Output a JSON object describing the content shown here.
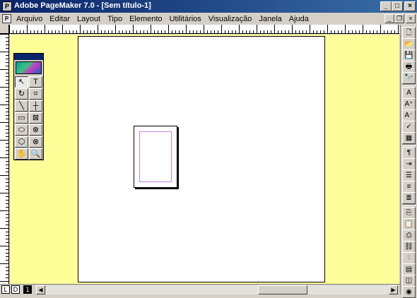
{
  "window": {
    "title": "Adobe PageMaker 7.0 - [Sem título-1]",
    "app_icon_label": "P",
    "minimize": "_",
    "maximize": "□",
    "close": "×"
  },
  "menubar": {
    "doc_icon_label": "P",
    "items": [
      "Arquivo",
      "Editar",
      "Layout",
      "Tipo",
      "Elemento",
      "Utilitários",
      "Visualização",
      "Janela",
      "Ajuda"
    ],
    "mdi_minimize": "_",
    "mdi_restore": "❐",
    "mdi_close": "×"
  },
  "toolbox": {
    "tools": [
      {
        "name": "pointer-tool-icon",
        "glyph": "↖"
      },
      {
        "name": "text-tool-icon",
        "glyph": "T"
      },
      {
        "name": "rotate-tool-icon",
        "glyph": "↻"
      },
      {
        "name": "crop-tool-icon",
        "glyph": "⌗"
      },
      {
        "name": "line-tool-icon",
        "glyph": "╲"
      },
      {
        "name": "constrained-line-tool-icon",
        "glyph": "┼"
      },
      {
        "name": "rectangle-tool-icon",
        "glyph": "▭"
      },
      {
        "name": "rectangle-frame-tool-icon",
        "glyph": "⊠"
      },
      {
        "name": "ellipse-tool-icon",
        "glyph": "⬭"
      },
      {
        "name": "ellipse-frame-tool-icon",
        "glyph": "⊗"
      },
      {
        "name": "polygon-tool-icon",
        "glyph": "⬡"
      },
      {
        "name": "polygon-frame-tool-icon",
        "glyph": "⊗"
      },
      {
        "name": "hand-tool-icon",
        "glyph": "✋"
      },
      {
        "name": "zoom-tool-icon",
        "glyph": "🔍"
      }
    ]
  },
  "right_toolbar": {
    "buttons": [
      {
        "name": "new-document-icon",
        "glyph": "🗋",
        "dim": false
      },
      {
        "name": "open-icon",
        "glyph": "📂",
        "dim": false
      },
      {
        "name": "save-icon",
        "glyph": "💾",
        "dim": false
      },
      {
        "name": "print-icon",
        "glyph": "🖶",
        "dim": false
      },
      {
        "name": "find-icon",
        "glyph": "🔭",
        "dim": false
      },
      {
        "name": "font-icon",
        "glyph": "A",
        "dim": false
      },
      {
        "name": "font-size-up-icon",
        "glyph": "A⁺",
        "dim": false
      },
      {
        "name": "font-size-down-icon",
        "glyph": "A⁻",
        "dim": false
      },
      {
        "name": "spell-check-icon",
        "glyph": "✓",
        "dim": false
      },
      {
        "name": "color-icon",
        "glyph": "▦",
        "dim": false
      },
      {
        "name": "paragraph-icon",
        "glyph": "¶",
        "dim": false
      },
      {
        "name": "indent-icon",
        "glyph": "⇥",
        "dim": false
      },
      {
        "name": "bullets-icon",
        "glyph": "☰",
        "dim": false
      },
      {
        "name": "align-left-icon",
        "glyph": "≡",
        "dim": false
      },
      {
        "name": "align-right-icon",
        "glyph": "≣",
        "dim": false
      },
      {
        "name": "copy-icon",
        "glyph": "⎘",
        "dim": false
      },
      {
        "name": "paste-icon",
        "glyph": "📋",
        "dim": true
      },
      {
        "name": "place-icon",
        "glyph": "⎙",
        "dim": false
      },
      {
        "name": "link-icon",
        "glyph": "⛓",
        "dim": false
      },
      {
        "name": "export-icon",
        "glyph": "⇪",
        "dim": true
      },
      {
        "name": "pdf-icon",
        "glyph": "▤",
        "dim": false
      },
      {
        "name": "html-icon",
        "glyph": "◫",
        "dim": false
      },
      {
        "name": "web-icon",
        "glyph": "◉",
        "dim": false
      }
    ]
  },
  "bottombar": {
    "left_page": "L",
    "right_page": "D",
    "page_1": "1",
    "scroll_left": "◀",
    "scroll_right": "▶"
  }
}
